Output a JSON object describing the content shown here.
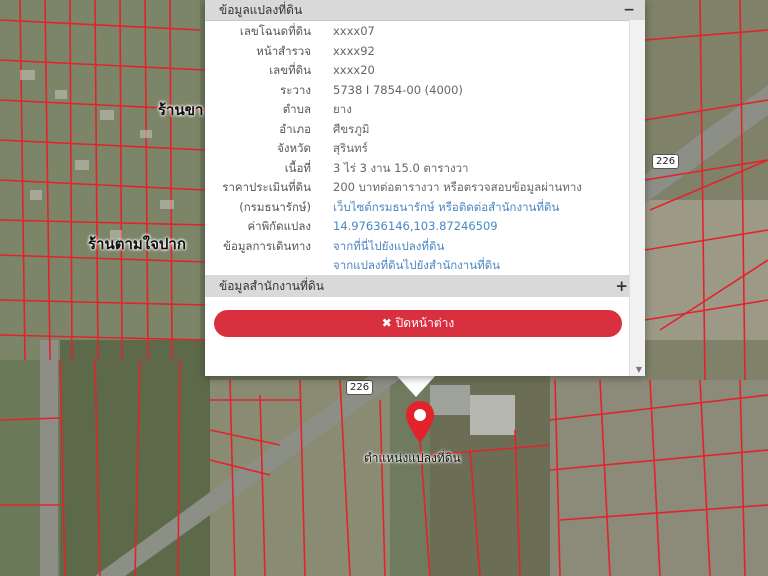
{
  "map": {
    "labels": [
      {
        "text": "ร้านขา",
        "name": "village-label-top"
      },
      {
        "text": "ร้านตามใจปาก",
        "name": "shop-label"
      },
      {
        "text": "ตำแหน่งแปลงที่ดิน",
        "name": "parcel-position-label"
      }
    ],
    "road_shields": [
      "226",
      "226"
    ],
    "colors": {
      "parcel_lines": "#e3232c",
      "imagery": "#6f7a5e",
      "road": "#8b8f86"
    }
  },
  "popup": {
    "title": "ข้อมูลแปลงที่ดิน",
    "collapse_icon": "minus",
    "rows": [
      {
        "key": "เลขโฉนดที่ดิน",
        "value": "xxxx07",
        "link": false
      },
      {
        "key": "หน้าสำรวจ",
        "value": "xxxx92",
        "link": false
      },
      {
        "key": "เลขที่ดิน",
        "value": "xxxx20",
        "link": false
      },
      {
        "key": "ระวาง",
        "value": "5738 I 7854-00 (4000)",
        "link": false
      },
      {
        "key": "ตำบล",
        "value": "ยาง",
        "link": false
      },
      {
        "key": "อำเภอ",
        "value": "ศีขรภูมิ",
        "link": false
      },
      {
        "key": "จังหวัด",
        "value": "สุรินทร์",
        "link": false
      },
      {
        "key": "เนื้อที่",
        "value": "3 ไร่ 3 งาน 15.0 ตารางวา",
        "link": false
      },
      {
        "key": "ราคาประเมินที่ดิน",
        "value": "200 บาทต่อตารางวา หรือตรวจสอบข้อมูลผ่านทาง",
        "link": false
      },
      {
        "key": "(กรมธนารักษ์)",
        "value": "เว็บไซต์กรมธนารักษ์ หรือติดต่อสำนักงานที่ดิน",
        "link": true
      },
      {
        "key": "ค่าพิกัดแปลง",
        "value": "14.97636146,103.87246509",
        "link": true
      },
      {
        "key": "ข้อมูลการเดินทาง",
        "value": "จากที่นี่ไปยังแปลงที่ดิน",
        "link": true
      },
      {
        "key": "",
        "value": "จากแปลงที่ดินไปยังสำนักงานที่ดิน",
        "link": true
      }
    ],
    "office_section": {
      "title": "ข้อมูลสำนักงานที่ดิน",
      "expand_icon": "plus"
    },
    "close_button": {
      "label": "ปิดหน้าต่าง",
      "icon": "x-icon",
      "color": "#d9303f"
    }
  }
}
